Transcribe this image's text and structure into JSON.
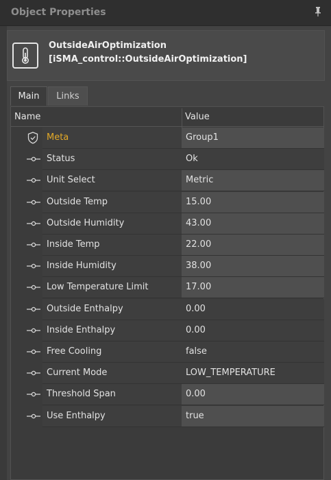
{
  "panel": {
    "title": "Object Properties"
  },
  "object": {
    "name": "OutsideAirOptimization",
    "type": "[iSMA_control::OutsideAirOptimization]",
    "icon": "thermometer-icon"
  },
  "tabs": [
    {
      "label": "Main",
      "active": true
    },
    {
      "label": "Links",
      "active": false
    }
  ],
  "columns": {
    "name": "Name",
    "value": "Value"
  },
  "rows": [
    {
      "name": "Meta",
      "value": "Group1",
      "kind": "meta",
      "shade": "light"
    },
    {
      "name": "Status",
      "value": "Ok",
      "kind": "slot",
      "shade": "dark"
    },
    {
      "name": "Unit Select",
      "value": "Metric",
      "kind": "slot",
      "shade": "light"
    },
    {
      "name": "Outside Temp",
      "value": "15.00",
      "kind": "slot",
      "shade": "light"
    },
    {
      "name": "Outside Humidity",
      "value": "43.00",
      "kind": "slot",
      "shade": "light"
    },
    {
      "name": "Inside Temp",
      "value": "22.00",
      "kind": "slot",
      "shade": "light"
    },
    {
      "name": "Inside Humidity",
      "value": "38.00",
      "kind": "slot",
      "shade": "light"
    },
    {
      "name": "Low Temperature Limit",
      "value": "17.00",
      "kind": "slot",
      "shade": "light"
    },
    {
      "name": "Outside Enthalpy",
      "value": "0.00",
      "kind": "slot",
      "shade": "dark"
    },
    {
      "name": "Inside Enthalpy",
      "value": "0.00",
      "kind": "slot",
      "shade": "dark"
    },
    {
      "name": "Free Cooling",
      "value": "false",
      "kind": "slot",
      "shade": "dark"
    },
    {
      "name": "Current Mode",
      "value": "LOW_TEMPERATURE",
      "kind": "slot",
      "shade": "dark"
    },
    {
      "name": "Threshold Span",
      "value": "0.00",
      "kind": "slot",
      "shade": "light"
    },
    {
      "name": "Use Enthalpy",
      "value": "true",
      "kind": "slot",
      "shade": "light"
    }
  ],
  "colors": {
    "meta_label": "#e3a927",
    "background": "#3a3a3a",
    "value_cell_light": "#4f4f4f"
  }
}
